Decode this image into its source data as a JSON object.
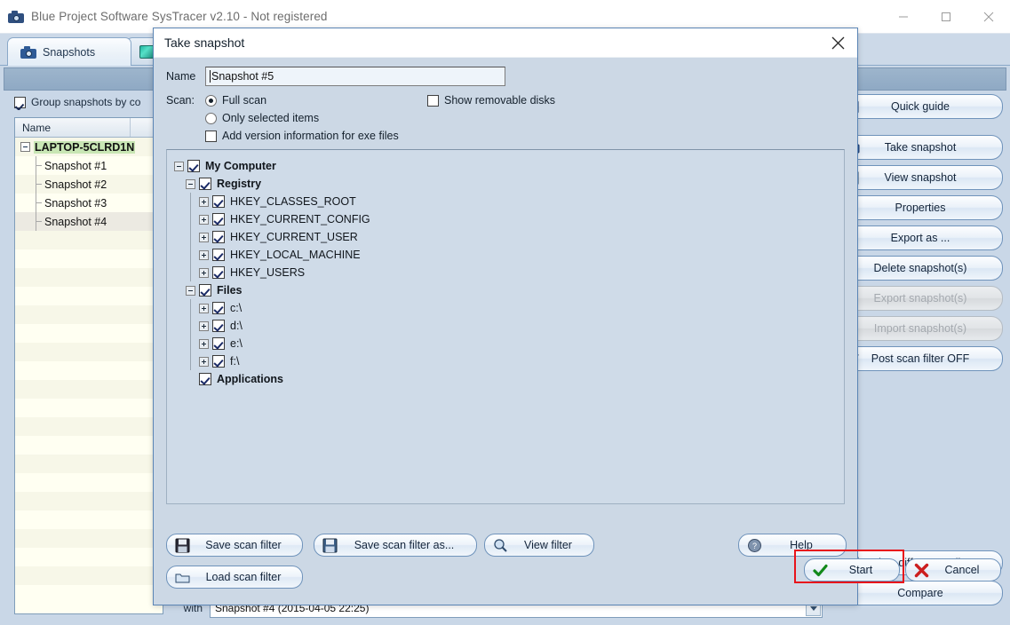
{
  "window": {
    "title": "Blue Project Software SysTracer v2.10 - Not registered",
    "icon": "camera-icon",
    "controls": {
      "minimize": "minimize-icon",
      "maximize": "maximize-icon",
      "close": "close-icon"
    }
  },
  "tabs": [
    {
      "label": "Snapshots",
      "icon": "camera-icon",
      "active": true
    },
    {
      "label": "",
      "icon": "puzzle-icon",
      "active": false
    }
  ],
  "left_panel": {
    "group_checkbox": {
      "label": "Group snapshots by co",
      "checked": true
    },
    "list_header": "Name",
    "rows": [
      {
        "label": "LAPTOP-5CLRD1N",
        "level": 0,
        "root": true,
        "expander": "minus"
      },
      {
        "label": "Snapshot #1",
        "level": 1
      },
      {
        "label": "Snapshot #2",
        "level": 1
      },
      {
        "label": "Snapshot #3",
        "level": 1
      },
      {
        "label": "Snapshot #4",
        "level": 1,
        "selected": true
      }
    ]
  },
  "right_buttons": [
    {
      "label": "Quick guide",
      "icon": "book-icon",
      "enabled": true
    },
    {
      "label": "Take snapshot",
      "icon": "camera-icon",
      "enabled": true
    },
    {
      "label": "View snapshot",
      "icon": "view-icon",
      "enabled": true
    },
    {
      "label": "Properties",
      "icon": "properties-icon",
      "enabled": true
    },
    {
      "label": "Export as ...",
      "icon": "export-icon",
      "enabled": true
    },
    {
      "label": "Delete snapshot(s)",
      "icon": "delete-icon",
      "enabled": true
    },
    {
      "label": "Export snapshot(s)",
      "icon": "export-snapshot-icon",
      "enabled": false
    },
    {
      "label": "Import snapshot(s)",
      "icon": "import-snapshot-icon",
      "enabled": false
    },
    {
      "label": "Post scan filter OFF",
      "icon": "filter-icon",
      "enabled": true
    }
  ],
  "bottom_buttons": [
    {
      "label": "View differences list",
      "icon": "differences-icon",
      "enabled": true
    },
    {
      "label": "Compare",
      "icon": "compare-icon",
      "enabled": true
    }
  ],
  "compare_area": {
    "label": "with",
    "value": "Snapshot #4 (2015-04-05 22:25)",
    "arrow": "chevron-down-icon"
  },
  "dialog": {
    "title": "Take snapshot",
    "close_icon": "close-icon",
    "name_label": "Name",
    "name_value": "Snapshot #5",
    "scan_label": "Scan:",
    "options": {
      "full_scan": {
        "label": "Full scan",
        "selected": true
      },
      "only_selected": {
        "label": "Only selected items",
        "selected": false
      },
      "show_removable": {
        "label": "Show removable disks",
        "checked": false
      },
      "add_version_info": {
        "label": "Add version information for exe files",
        "checked": false
      }
    },
    "tree": [
      {
        "label": "My Computer",
        "level": 0,
        "checked": true,
        "bold": true,
        "expander": "minus"
      },
      {
        "label": "Registry",
        "level": 1,
        "checked": true,
        "bold": true,
        "expander": "minus"
      },
      {
        "label": "HKEY_CLASSES_ROOT",
        "level": 2,
        "checked": true,
        "bold": false,
        "expander": "plus"
      },
      {
        "label": "HKEY_CURRENT_CONFIG",
        "level": 2,
        "checked": true,
        "bold": false,
        "expander": "plus"
      },
      {
        "label": "HKEY_CURRENT_USER",
        "level": 2,
        "checked": true,
        "bold": false,
        "expander": "plus"
      },
      {
        "label": "HKEY_LOCAL_MACHINE",
        "level": 2,
        "checked": true,
        "bold": false,
        "expander": "plus"
      },
      {
        "label": "HKEY_USERS",
        "level": 2,
        "checked": true,
        "bold": false,
        "expander": "plus"
      },
      {
        "label": "Files",
        "level": 1,
        "checked": true,
        "bold": true,
        "expander": "minus"
      },
      {
        "label": "c:\\",
        "level": 2,
        "checked": true,
        "bold": false,
        "expander": "plus"
      },
      {
        "label": "d:\\",
        "level": 2,
        "checked": true,
        "bold": false,
        "expander": "plus"
      },
      {
        "label": "e:\\",
        "level": 2,
        "checked": true,
        "bold": false,
        "expander": "plus"
      },
      {
        "label": "f:\\",
        "level": 2,
        "checked": true,
        "bold": false,
        "expander": "plus"
      },
      {
        "label": "Applications",
        "level": 1,
        "checked": true,
        "bold": true,
        "expander": "none"
      }
    ],
    "footer": {
      "save_scan_filter": {
        "label": "Save scan filter",
        "icon": "floppy-icon"
      },
      "save_scan_filter_as": {
        "label": "Save scan filter as...",
        "icon": "floppy-pen-icon"
      },
      "view_filter": {
        "label": "View filter",
        "icon": "magnifier-icon"
      },
      "load_scan_filter": {
        "label": "Load scan filter",
        "icon": "folder-icon"
      },
      "help": {
        "label": "Help",
        "icon": "help-icon"
      },
      "start": {
        "label": "Start",
        "icon": "check-icon",
        "highlighted": true
      },
      "cancel": {
        "label": "Cancel",
        "icon": "x-icon"
      }
    }
  },
  "colors": {
    "highlight_box": "#e8141b",
    "window_bg": "#c9d7e7",
    "dialog_bg": "#ccd8e5",
    "root_highlight": "#c8e6b4"
  }
}
